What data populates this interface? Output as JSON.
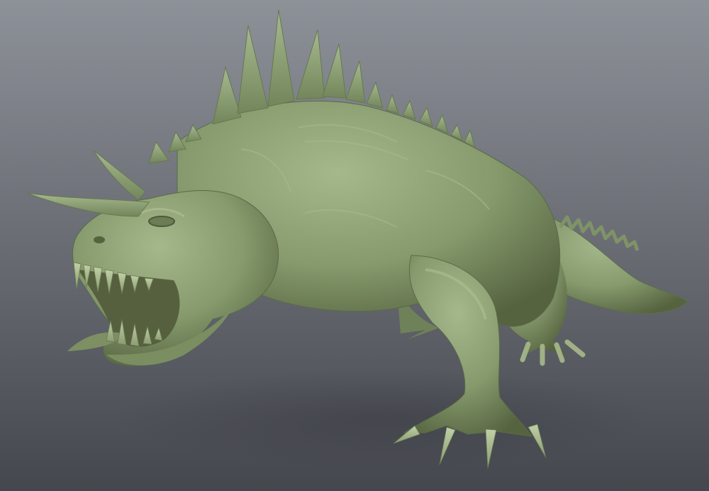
{
  "scene": {
    "subject": "creature-sculpt",
    "background_top": "#8c9097",
    "background_bottom": "#44464d",
    "clay_color": "#8a9e72",
    "clay_shadow": "#4e5c40",
    "clay_highlight": "#b3c49a",
    "mouth_interior": "#56603f"
  }
}
